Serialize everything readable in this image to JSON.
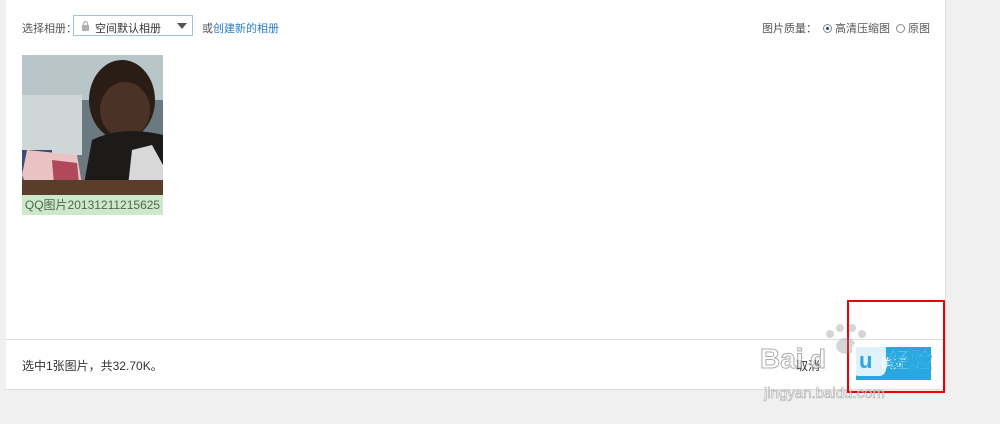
{
  "toolbar": {
    "album_label": "选择相册：",
    "album_selected": "空间默认相册",
    "or_text": "或",
    "create_album_link": "创建新的相册",
    "quality_label": "图片质量：",
    "quality_options": [
      {
        "label": "高清压缩图",
        "checked": true
      },
      {
        "label": "原图",
        "checked": false
      }
    ]
  },
  "photos": [
    {
      "caption": "QQ图片20131211215625"
    }
  ],
  "footer": {
    "status_text": "选中1张图片，共32.70K。",
    "cancel_label": "取消",
    "confirm_label": "确定"
  },
  "colors": {
    "accent": "#29a8e0",
    "link": "#2b7ec1",
    "caption_bg": "#cde8cd",
    "highlight": "#ee0000"
  },
  "watermark": {
    "text": "Baidu经验",
    "url_text": "jingyan.baidu.com"
  }
}
